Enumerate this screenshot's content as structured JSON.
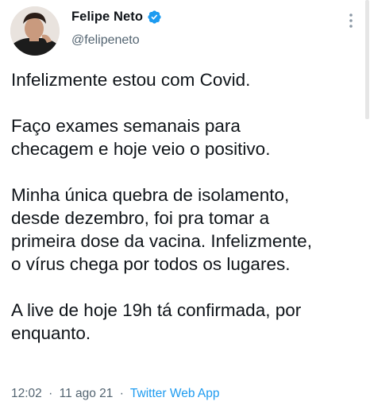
{
  "author": {
    "display_name": "Felipe Neto",
    "handle": "@felipeneto",
    "verified_icon": "verified-badge-icon",
    "avatar": "profile-photo"
  },
  "tweet": {
    "lines": {
      "l1": "Infelizmente estou com Covid.",
      "l2": "Faço exames semanais para",
      "l3": "checagem e hoje veio o positivo.",
      "l4": "Minha única quebra de isolamento,",
      "l5": "desde dezembro, foi pra tomar a",
      "l6": "primeira dose da vacina. Infelizmente,",
      "l7": "o vírus chega por todos os lugares.",
      "l8": "A live de hoje 19h tá confirmada, por",
      "l9": "enquanto."
    }
  },
  "meta": {
    "time": "12:02",
    "date": "11 ago 21",
    "separator": "·",
    "source": "Twitter Web App"
  },
  "colors": {
    "text": "#0f1419",
    "secondary": "#536471",
    "accent": "#1d9bf0"
  },
  "icons": {
    "more": "more-vertical-icon"
  }
}
